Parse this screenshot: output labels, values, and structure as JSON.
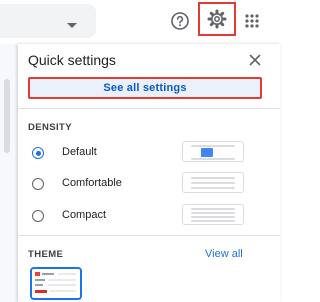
{
  "topbar": {
    "icons": {
      "dropdown": "chevron-down-icon",
      "help": "help-icon",
      "settings": "gear-icon",
      "apps": "apps-grid-icon"
    }
  },
  "quick_settings": {
    "title": "Quick settings",
    "see_all_label": "See all settings",
    "density": {
      "label": "DENSITY",
      "options": [
        {
          "label": "Default",
          "selected": true
        },
        {
          "label": "Comfortable",
          "selected": false
        },
        {
          "label": "Compact",
          "selected": false
        }
      ]
    },
    "theme": {
      "label": "THEME",
      "view_all_label": "View all"
    }
  },
  "colors": {
    "accent": "#1a73e8",
    "highlight_border": "#e53935",
    "button_bg": "#eaf1fb"
  }
}
